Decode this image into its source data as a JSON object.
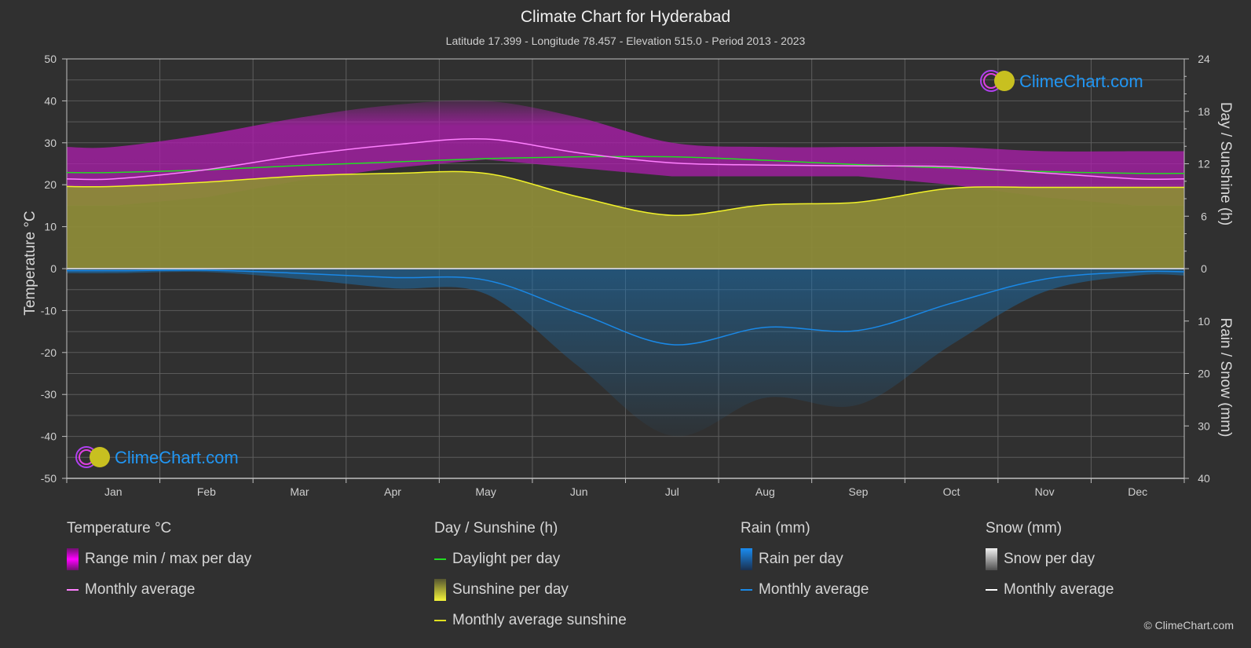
{
  "header": {
    "title": "Climate Chart for Hyderabad",
    "subtitle": "Latitude 17.399 - Longitude 78.457 - Elevation 515.0 - Period 2013 - 2023"
  },
  "logo_text": "ClimeChart.com",
  "copyright": "© ClimeChart.com",
  "colors": {
    "background": "#303030",
    "temp_range": "#c020c0",
    "temp_avg": "#ff80ff",
    "daylight": "#22dd22",
    "sunshine_fill": "#8c8a38",
    "sunshine_avg": "#f2f22a",
    "rain": "#1a88e6",
    "snow_avg": "#ffffff",
    "logo_blue": "#2196f3"
  },
  "chart_data": {
    "type": "line",
    "title": "Climate Chart for Hyderabad",
    "categories": [
      "Jan",
      "Feb",
      "Mar",
      "Apr",
      "May",
      "Jun",
      "Jul",
      "Aug",
      "Sep",
      "Oct",
      "Nov",
      "Dec"
    ],
    "left_axis": {
      "label": "Temperature °C",
      "range": [
        -50,
        50
      ],
      "ticks": [
        50,
        40,
        30,
        20,
        10,
        0,
        -10,
        -20,
        -30,
        -40,
        -50
      ]
    },
    "right_axis_top": {
      "label": "Day / Sunshine (h)",
      "range": [
        0,
        24
      ],
      "ticks": [
        24,
        18,
        12,
        6,
        0
      ]
    },
    "right_axis_bottom": {
      "label": "Rain / Snow (mm)",
      "range": [
        0,
        40
      ],
      "ticks": [
        10,
        20,
        30,
        40
      ]
    },
    "grid": true,
    "series": [
      {
        "name": "Temperature monthly average",
        "axis": "temperature",
        "values": [
          21.4,
          23.6,
          27.0,
          29.5,
          30.9,
          27.6,
          25.2,
          24.7,
          24.5,
          24.3,
          22.8,
          21.4
        ]
      },
      {
        "name": "Temperature range max (approx)",
        "axis": "temperature",
        "values": [
          29,
          32,
          36,
          39,
          40,
          36,
          30,
          29,
          29,
          29,
          28,
          28
        ]
      },
      {
        "name": "Temperature range min (approx)",
        "axis": "temperature",
        "values": [
          15,
          17,
          21,
          24,
          26,
          24,
          22,
          22,
          22,
          20,
          17,
          15
        ]
      },
      {
        "name": "Daylight per day",
        "axis": "hours",
        "values": [
          11.0,
          11.3,
          11.8,
          12.2,
          12.6,
          12.8,
          12.8,
          12.4,
          11.9,
          11.5,
          11.1,
          10.9
        ]
      },
      {
        "name": "Monthly average sunshine",
        "axis": "hours",
        "values": [
          9.4,
          9.9,
          10.6,
          10.9,
          10.9,
          8.2,
          6.1,
          7.3,
          7.6,
          9.2,
          9.3,
          9.3
        ]
      },
      {
        "name": "Rain monthly average",
        "axis": "mm",
        "values": [
          0.4,
          0.3,
          0.9,
          1.7,
          2.2,
          8.5,
          14.5,
          11.2,
          11.8,
          6.6,
          2.0,
          0.6
        ]
      },
      {
        "name": "Snow monthly average",
        "axis": "mm",
        "values": [
          0,
          0,
          0,
          0,
          0,
          0,
          0,
          0,
          0,
          0,
          0,
          0
        ]
      }
    ]
  },
  "legend": {
    "groups": [
      {
        "title": "Temperature °C",
        "items": [
          {
            "label": "Range min / max per day",
            "swatch": "box-magenta"
          },
          {
            "label": "Monthly average",
            "swatch": "line-pink"
          }
        ]
      },
      {
        "title": "Day / Sunshine (h)",
        "items": [
          {
            "label": "Daylight per day",
            "swatch": "line-green"
          },
          {
            "label": "Sunshine per day",
            "swatch": "box-yellow"
          },
          {
            "label": "Monthly average sunshine",
            "swatch": "line-yellow"
          }
        ]
      },
      {
        "title": "Rain (mm)",
        "items": [
          {
            "label": "Rain per day",
            "swatch": "box-blue"
          },
          {
            "label": "Monthly average",
            "swatch": "line-blue"
          }
        ]
      },
      {
        "title": "Snow (mm)",
        "items": [
          {
            "label": "Snow per day",
            "swatch": "box-white"
          },
          {
            "label": "Monthly average",
            "swatch": "line-white"
          }
        ]
      }
    ]
  }
}
